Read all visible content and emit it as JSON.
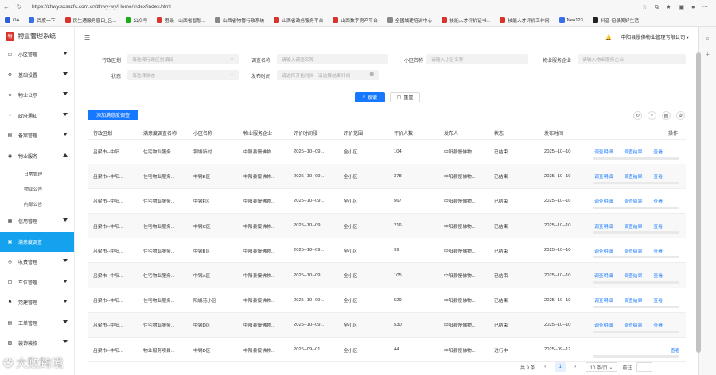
{
  "browser": {
    "url": "https://zhwy.sxsszfc.com.cn/zhwy-wy/Home/Index/index.html",
    "bookmarks": [
      {
        "label": "OA",
        "color": "#2b5fd9"
      },
      {
        "label": "百度一下",
        "color": "#3a6ee8"
      },
      {
        "label": "民生通服务窗口_吕...",
        "color": "#d9342b"
      },
      {
        "label": "公众号",
        "color": "#1aad19"
      },
      {
        "label": "登录 - 山西省智慧...",
        "color": "#d9342b"
      },
      {
        "label": "山西省物管行政系统",
        "color": "#888888"
      },
      {
        "label": "山西省政务服务平台",
        "color": "#d9342b"
      },
      {
        "label": "山西数字房产平台",
        "color": "#d9342b"
      },
      {
        "label": "全国城建培训中心",
        "color": "#888888"
      },
      {
        "label": "技能人才评价证书...",
        "color": "#d9342b"
      },
      {
        "label": "技能人才评价工作网",
        "color": "#d9342b"
      },
      {
        "label": "Neo123",
        "color": "#3a6ee8"
      },
      {
        "label": "抖音-记录美好生活",
        "color": "#222222"
      }
    ]
  },
  "app": {
    "title": "物业管理系统",
    "logo_char": "物",
    "company": "中阳县慢佛物业管理有限公司"
  },
  "sidebar": {
    "items": [
      {
        "label": "小区管理",
        "icon": "folder-icon"
      },
      {
        "label": "基础设置",
        "icon": "settings-icon"
      },
      {
        "label": "物业公示",
        "icon": "notice-icon"
      },
      {
        "label": "政府通知",
        "icon": "bell-icon"
      },
      {
        "label": "备案管理",
        "icon": "file-icon"
      },
      {
        "label": "物业服务",
        "icon": "service-icon"
      }
    ],
    "sub_items": [
      "日常管理",
      "物业公告",
      "内部公告"
    ],
    "items2": [
      {
        "label": "信用管理",
        "icon": "credit-icon"
      },
      {
        "label": "满意度调查",
        "icon": "survey-icon",
        "active": true
      },
      {
        "label": "收费管理",
        "icon": "money-icon"
      },
      {
        "label": "车位管理",
        "icon": "parking-icon"
      },
      {
        "label": "党建管理",
        "icon": "party-icon"
      },
      {
        "label": "工单管理",
        "icon": "ticket-icon"
      },
      {
        "label": "装饰装修",
        "icon": "decor-icon"
      }
    ]
  },
  "filters": {
    "region_label": "行政区划",
    "region_placeholder": "请选择行政区划编码",
    "survey_label": "调查名称",
    "survey_placeholder": "请输入调查名称",
    "community_label": "小区名称",
    "community_placeholder": "请输入小区名称",
    "company_label": "物业服务企业",
    "company_placeholder": "请输入物业服务企业",
    "status_label": "状态",
    "status_placeholder": "请选择状态",
    "time_label": "发布时间",
    "time_start": "请选择开始时间",
    "time_sep": "-",
    "time_end": "请选择结束时间",
    "search_btn": "搜索",
    "reset_btn": "重置"
  },
  "toolbar": {
    "add_btn": "添加满意度调查"
  },
  "table": {
    "headers": [
      "行政区划",
      "满意度调查名称",
      "小区名称",
      "物业服务企业",
      "评价时间段",
      "评价范围",
      "评价人数",
      "发布人",
      "状态",
      "发布时间",
      "操作"
    ],
    "op_detail": "调查明细",
    "op_result": "调查结果",
    "op_view": "查看",
    "rows": [
      {
        "region": "吕梁市--中阳...",
        "name": "住宅物业服务...",
        "community": "铜城新村",
        "company": "中阳县慢佛物...",
        "period": "2025--10--09...",
        "scope": "全小区",
        "count": "104",
        "publisher": "中阳县慢佛物...",
        "status": "已结束",
        "time": "2025--10--10",
        "ops": 3
      },
      {
        "region": "吕梁市--中阳...",
        "name": "住宅物业服务...",
        "community": "中钢E区",
        "company": "中阳县慢佛物...",
        "period": "2025--10--09...",
        "scope": "全小区",
        "count": "378",
        "publisher": "中阳县慢佛物...",
        "status": "已结束",
        "time": "2025--10--10",
        "ops": 3
      },
      {
        "region": "吕梁市--中阳...",
        "name": "住宅物业服务...",
        "community": "中钢F区",
        "company": "中阳县慢佛物...",
        "period": "2025--10--09...",
        "scope": "全小区",
        "count": "567",
        "publisher": "中阳县慢佛物...",
        "status": "已结束",
        "time": "2025--10--10",
        "ops": 3
      },
      {
        "region": "吕梁市--中阳...",
        "name": "住宅物业服务...",
        "community": "中钢C区",
        "company": "中阳县慢佛物...",
        "period": "2025--10--09...",
        "scope": "全小区",
        "count": "216",
        "publisher": "中阳县慢佛物...",
        "status": "已结束",
        "time": "2025--10--10",
        "ops": 3
      },
      {
        "region": "吕梁市--中阳...",
        "name": "住宅物业服务...",
        "community": "中钢B区",
        "company": "中阳县慢佛物...",
        "period": "2025--10--09...",
        "scope": "全小区",
        "count": "99",
        "publisher": "中阳县慢佛物...",
        "status": "已结束",
        "time": "2025--10--10",
        "ops": 3
      },
      {
        "region": "吕梁市--中阳...",
        "name": "住宅物业服务...",
        "community": "中钢A区",
        "company": "中阳县慢佛物...",
        "period": "2025--10--09...",
        "scope": "全小区",
        "count": "105",
        "publisher": "中阳县慢佛物...",
        "status": "已结束",
        "time": "2025--10--10",
        "ops": 3
      },
      {
        "region": "吕梁市--中阳...",
        "name": "住宅物业服务...",
        "community": "阳城苑小区",
        "company": "中阳县慢佛物...",
        "period": "2025--10--09...",
        "scope": "全小区",
        "count": "529",
        "publisher": "中阳县慢佛物...",
        "status": "已结束",
        "time": "2025--10--10",
        "ops": 3
      },
      {
        "region": "吕梁市--中阳...",
        "name": "住宅物业服务...",
        "community": "中钢D区",
        "company": "中阳县慢佛物...",
        "period": "2025--10--09...",
        "scope": "全小区",
        "count": "530",
        "publisher": "中阳县慢佛物...",
        "status": "已结束",
        "time": "2025--10--10",
        "ops": 3
      },
      {
        "region": "吕梁市--中阳...",
        "name": "物业服务项目...",
        "community": "中钢D区",
        "company": "中阳县慢佛物...",
        "period": "2025--09--01...",
        "scope": "全小区",
        "count": "44",
        "publisher": "中阳县慢佛物...",
        "status": "进行中",
        "time": "2025--09--12",
        "ops": 1
      }
    ]
  },
  "pagination": {
    "total": "共 9 条",
    "prev": "‹",
    "current": "1",
    "next": "›",
    "page_size": "10 条/页",
    "goto": "前往"
  },
  "watermark": {
    "text": "大败跨境"
  }
}
